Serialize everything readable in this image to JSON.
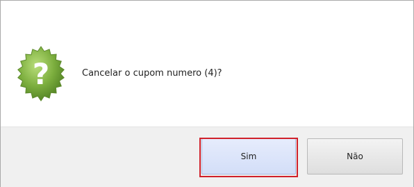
{
  "dialog": {
    "message": "Cancelar o cupom numero (4)?",
    "icon": "question-seal-icon",
    "buttons": {
      "yes_label": "Sim",
      "no_label": "Não"
    }
  },
  "colors": {
    "icon_green": "#7cae3e",
    "focus_outline": "#d0202a",
    "yes_button": "#dbe4fa",
    "footer_bg": "#f0f0f0"
  }
}
